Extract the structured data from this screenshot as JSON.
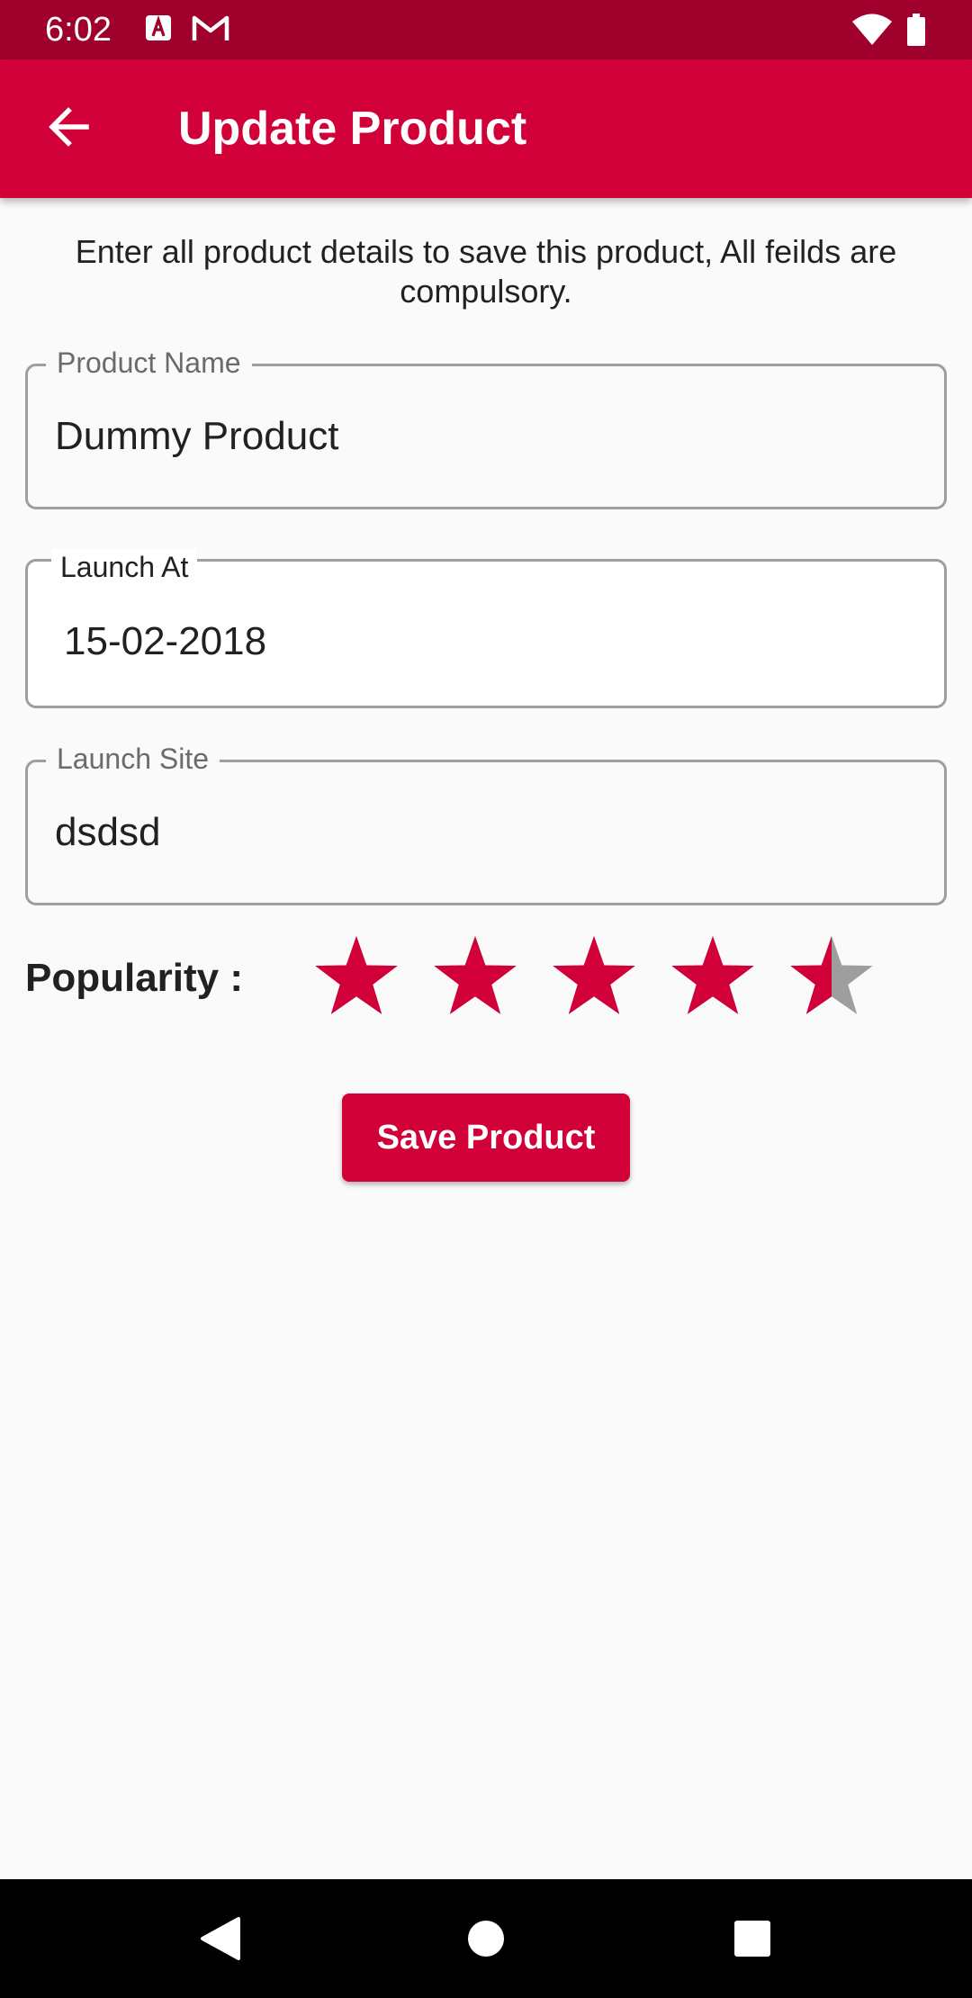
{
  "status_bar": {
    "time": "6:02",
    "icons": [
      "a-notification-icon",
      "gmail-icon",
      "wifi-icon",
      "battery-icon"
    ]
  },
  "app_bar": {
    "title": "Update Product",
    "back_icon": "arrow-back-icon"
  },
  "form": {
    "intro": "Enter all product details to save this product, All feilds are compulsory.",
    "product_name": {
      "label": "Product Name",
      "value": "Dummy Product"
    },
    "launch_at": {
      "label": "Launch At",
      "value": "15-02-2018"
    },
    "launch_site": {
      "label": "Launch Site",
      "value": "dsdsd"
    },
    "popularity": {
      "label": "Popularity :",
      "rating": 4.5,
      "max": 5
    },
    "save_label": "Save Product"
  },
  "colors": {
    "accent": "#d10038",
    "status_bar": "#a0002c",
    "star_empty": "#9e9e9e"
  },
  "nav_bar": {
    "icons": [
      "back-triangle-icon",
      "home-circle-icon",
      "recents-square-icon"
    ]
  }
}
